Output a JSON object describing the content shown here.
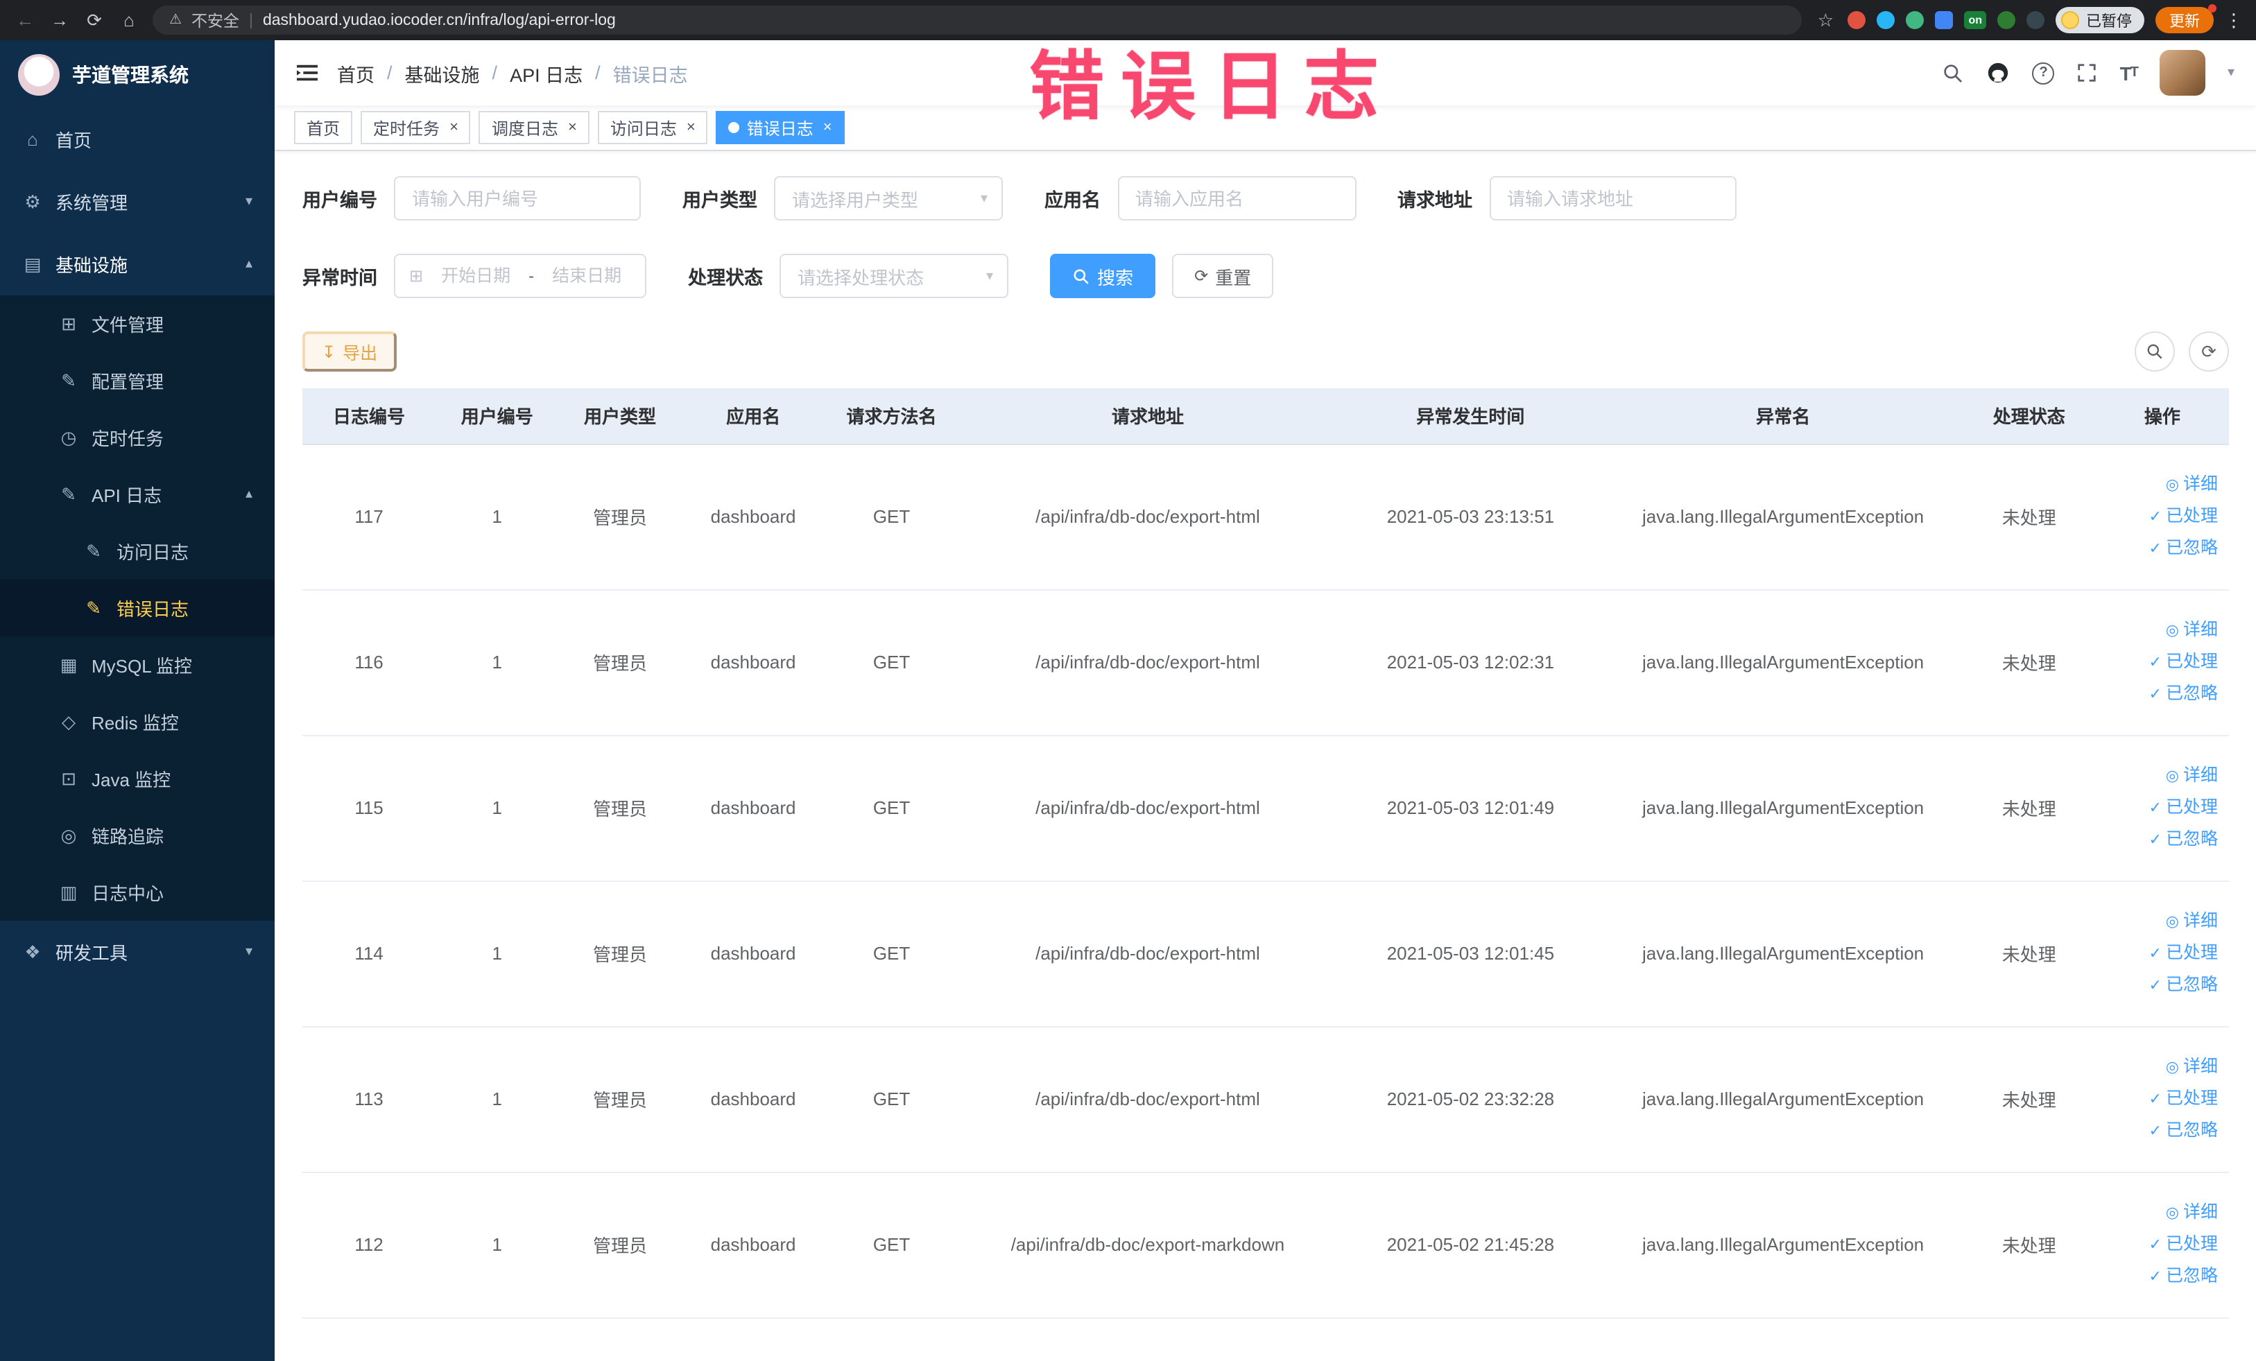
{
  "annotation": {
    "text": "错误日志"
  },
  "browser": {
    "security": "不安全",
    "url": "dashboard.yudao.iocoder.cn/infra/log/api-error-log",
    "on_badge": "on",
    "paused_badge": "已暂停",
    "update_button": "更新"
  },
  "sidebar": {
    "app_title": "芋道管理系统",
    "items": {
      "home": "首页",
      "system": "系统管理",
      "infra": "基础设施",
      "file": "文件管理",
      "config": "配置管理",
      "job": "定时任务",
      "api_log": "API 日志",
      "access_log": "访问日志",
      "error_log": "错误日志",
      "mysql": "MySQL 监控",
      "redis": "Redis 监控",
      "java": "Java 监控",
      "trace": "链路追踪",
      "log_center": "日志中心",
      "dev": "研发工具"
    }
  },
  "header": {
    "breadcrumb": {
      "items": [
        "首页",
        "基础设施",
        "API 日志",
        "错误日志"
      ],
      "separator": "/"
    }
  },
  "tabs": [
    {
      "label": "首页"
    },
    {
      "label": "定时任务"
    },
    {
      "label": "调度日志"
    },
    {
      "label": "访问日志"
    },
    {
      "label": "错误日志"
    }
  ],
  "filters": {
    "user_id": {
      "label": "用户编号",
      "placeholder": "请输入用户编号"
    },
    "user_type": {
      "label": "用户类型",
      "placeholder": "请选择用户类型"
    },
    "app_name": {
      "label": "应用名",
      "placeholder": "请输入应用名"
    },
    "request_url": {
      "label": "请求地址",
      "placeholder": "请输入请求地址"
    },
    "exception_time": {
      "label": "异常时间",
      "start": "开始日期",
      "separator": "-",
      "end": "结束日期"
    },
    "status": {
      "label": "处理状态",
      "placeholder": "请选择处理状态"
    },
    "search_label": "搜索",
    "reset_label": "重置"
  },
  "toolbar": {
    "export_label": "导出"
  },
  "table": {
    "headers": [
      "日志编号",
      "用户编号",
      "用户类型",
      "应用名",
      "请求方法名",
      "请求地址",
      "异常发生时间",
      "异常名",
      "处理状态",
      "操作"
    ],
    "action_labels": [
      "详细",
      "已处理",
      "已忽略"
    ],
    "rows": [
      {
        "id": "117",
        "user_id": "1",
        "user_type": "管理员",
        "app": "dashboard",
        "method": "GET",
        "url": "/api/infra/db-doc/export-html",
        "time": "2021-05-03 23:13:51",
        "exception": "java.lang.IllegalArgumentException",
        "status": "未处理"
      },
      {
        "id": "116",
        "user_id": "1",
        "user_type": "管理员",
        "app": "dashboard",
        "method": "GET",
        "url": "/api/infra/db-doc/export-html",
        "time": "2021-05-03 12:02:31",
        "exception": "java.lang.IllegalArgumentException",
        "status": "未处理"
      },
      {
        "id": "115",
        "user_id": "1",
        "user_type": "管理员",
        "app": "dashboard",
        "method": "GET",
        "url": "/api/infra/db-doc/export-html",
        "time": "2021-05-03 12:01:49",
        "exception": "java.lang.IllegalArgumentException",
        "status": "未处理"
      },
      {
        "id": "114",
        "user_id": "1",
        "user_type": "管理员",
        "app": "dashboard",
        "method": "GET",
        "url": "/api/infra/db-doc/export-html",
        "time": "2021-05-03 12:01:45",
        "exception": "java.lang.IllegalArgumentException",
        "status": "未处理"
      },
      {
        "id": "113",
        "user_id": "1",
        "user_type": "管理员",
        "app": "dashboard",
        "method": "GET",
        "url": "/api/infra/db-doc/export-html",
        "time": "2021-05-02 23:32:28",
        "exception": "java.lang.IllegalArgumentException",
        "status": "未处理"
      },
      {
        "id": "112",
        "user_id": "1",
        "user_type": "管理员",
        "app": "dashboard",
        "method": "GET",
        "url": "/api/infra/db-doc/export-markdown",
        "time": "2021-05-02 21:45:28",
        "exception": "java.lang.IllegalArgumentException",
        "status": "未处理"
      }
    ]
  }
}
